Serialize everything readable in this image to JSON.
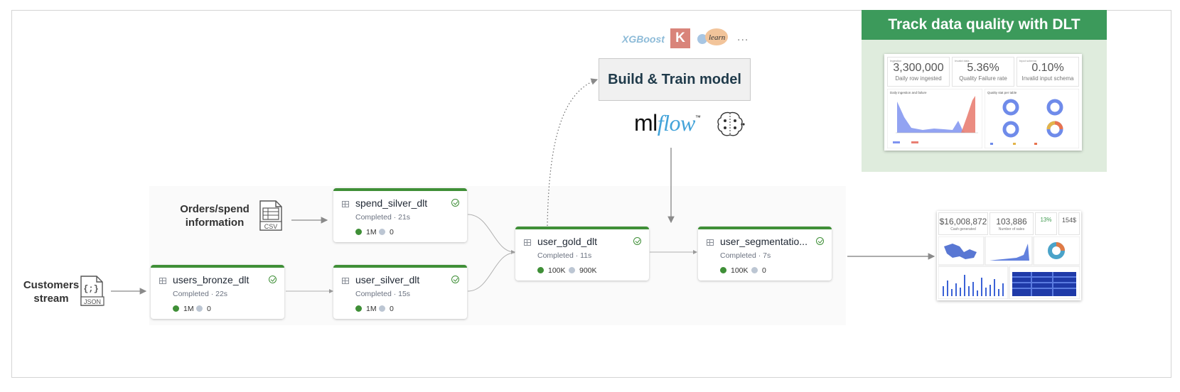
{
  "sources": {
    "orders_label_line1": "Orders/spend",
    "orders_label_line2": "information",
    "orders_file": "CSV",
    "customers_label_line1": "Customers",
    "customers_label_line2": "stream",
    "customers_file": "JSON",
    "customers_glyph": "{;}"
  },
  "nodes": {
    "spend_silver": {
      "name": "spend_silver_dlt",
      "status": "Completed · 21s",
      "rows": "1M",
      "dropped": "0"
    },
    "users_bronze": {
      "name": "users_bronze_dlt",
      "status": "Completed · 22s",
      "rows": "1M",
      "dropped": "0"
    },
    "user_silver": {
      "name": "user_silver_dlt",
      "status": "Completed · 15s",
      "rows": "1M",
      "dropped": "0"
    },
    "user_gold": {
      "name": "user_gold_dlt",
      "status": "Completed · 11s",
      "rows": "100K",
      "dropped": "900K"
    },
    "user_segmentation": {
      "name": "user_segmentatio...",
      "status": "Completed · 7s",
      "rows": "100K",
      "dropped": "0"
    }
  },
  "ml": {
    "build_label": "Build & Train model",
    "libs": {
      "xgboost": "XGBoost",
      "keras": "K",
      "sklearn": "learn",
      "more": "..."
    },
    "mlflow_ml": "ml",
    "mlflow_flow": "flow",
    "mlflow_tm": "™"
  },
  "data_quality": {
    "title": "Track data quality with DLT",
    "kpis": [
      {
        "value": "3,300,000",
        "label": "Daily row ingested",
        "caption": "Ingestion"
      },
      {
        "value": "5.36%",
        "label": "Quality Failure rate",
        "caption": "Invalid data"
      },
      {
        "value": "0.10%",
        "label": "Invalid input schema",
        "caption": "Input schema"
      }
    ],
    "chart1_title": "Daily ingestion and failure",
    "chart2_title": "Quality stat per table"
  },
  "sales_dashboard": {
    "kpis": [
      {
        "value": "$16,008,872",
        "label": "Cash generated"
      },
      {
        "value": "103,886",
        "label": "Number of sales"
      },
      {
        "value": "13%",
        "label": ""
      },
      {
        "value": "154$",
        "label": ""
      }
    ]
  },
  "colors": {
    "accent_green": "#3f8f37",
    "header_green": "#3c9a5b",
    "panel_green": "#dfecdd",
    "edge": "#9a9a9a"
  },
  "icons": [
    "csv-file-icon",
    "json-file-icon",
    "table-icon",
    "check-circle-icon",
    "brain-icon",
    "donut-chart-icon"
  ]
}
